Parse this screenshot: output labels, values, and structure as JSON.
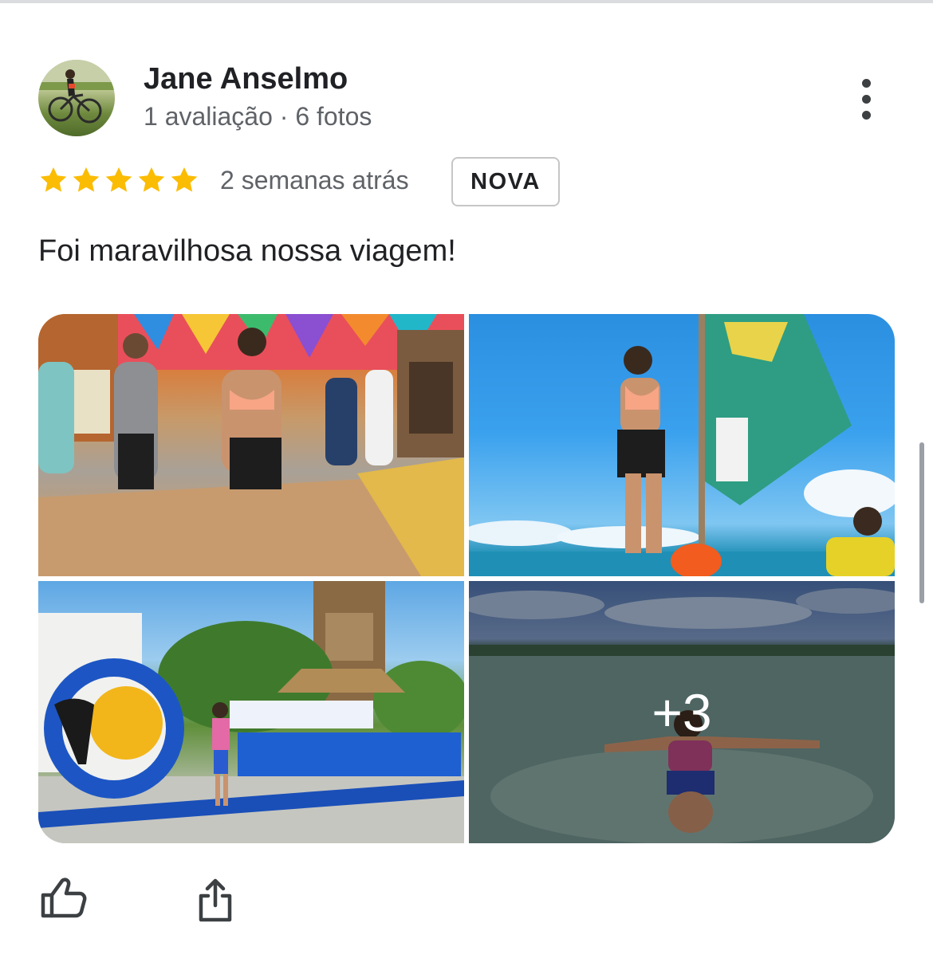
{
  "review": {
    "author": {
      "name": "Jane Anselmo",
      "meta": "1 avaliação · 6 fotos"
    },
    "rating": {
      "stars": 5,
      "max": 5,
      "color": "#fbbc04"
    },
    "time": "2 semanas atrás",
    "badge": "NOVA",
    "text": "Foi maravilhosa nossa viagem!",
    "photos": {
      "more_count_label": "+3"
    },
    "actions": {
      "like_icon": "thumbs-up-icon",
      "share_icon": "share-icon"
    }
  }
}
